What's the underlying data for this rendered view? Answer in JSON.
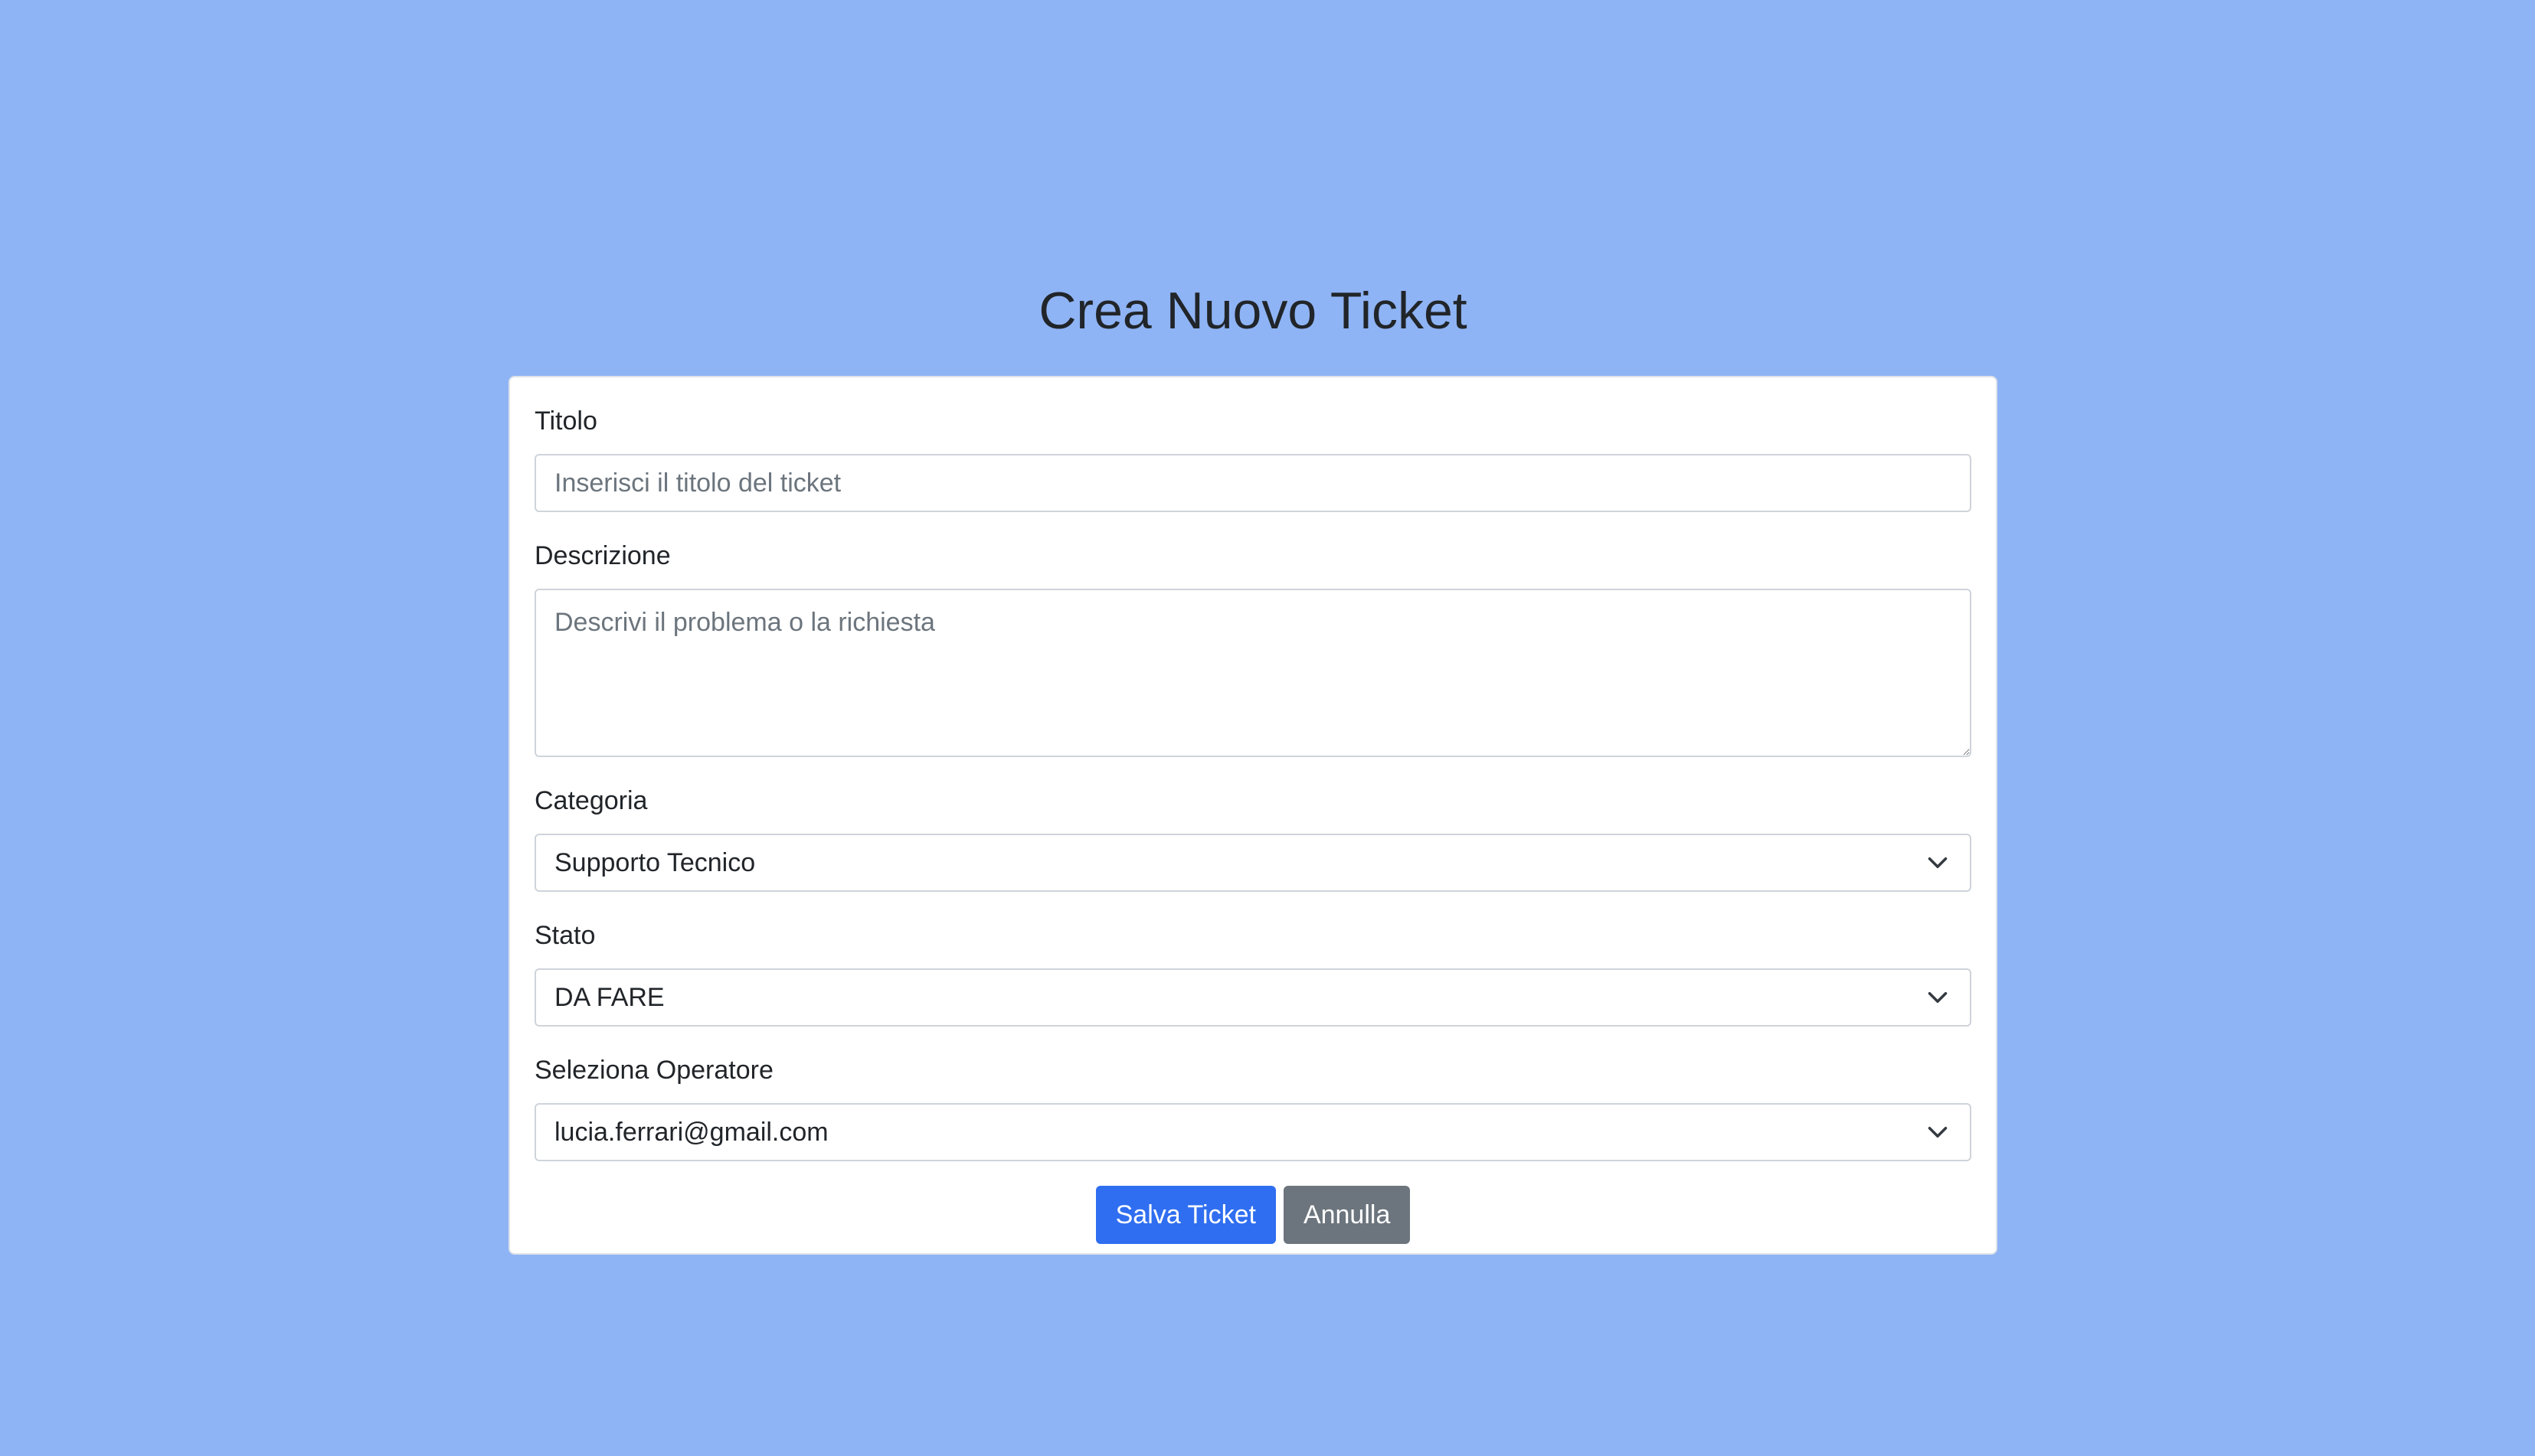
{
  "page": {
    "title": "Crea Nuovo Ticket"
  },
  "form": {
    "titolo": {
      "label": "Titolo",
      "value": "",
      "placeholder": "Inserisci il titolo del ticket"
    },
    "descrizione": {
      "label": "Descrizione",
      "value": "",
      "placeholder": "Descrivi il problema o la richiesta"
    },
    "categoria": {
      "label": "Categoria",
      "selected": "Supporto Tecnico",
      "icon": "chevron-down-icon"
    },
    "stato": {
      "label": "Stato",
      "selected": "DA FARE",
      "icon": "chevron-down-icon"
    },
    "operatore": {
      "label": "Seleziona Operatore",
      "selected": "lucia.ferrari@gmail.com",
      "icon": "chevron-down-icon"
    },
    "buttons": {
      "save_label": "Salva Ticket",
      "cancel_label": "Annulla"
    }
  },
  "colors": {
    "background": "#8fb4f5",
    "card": "#ffffff",
    "primary": "#2f6ef0",
    "secondary": "#6c757d",
    "text": "#212529",
    "placeholder": "#6c757d",
    "border": "#ced4da"
  }
}
